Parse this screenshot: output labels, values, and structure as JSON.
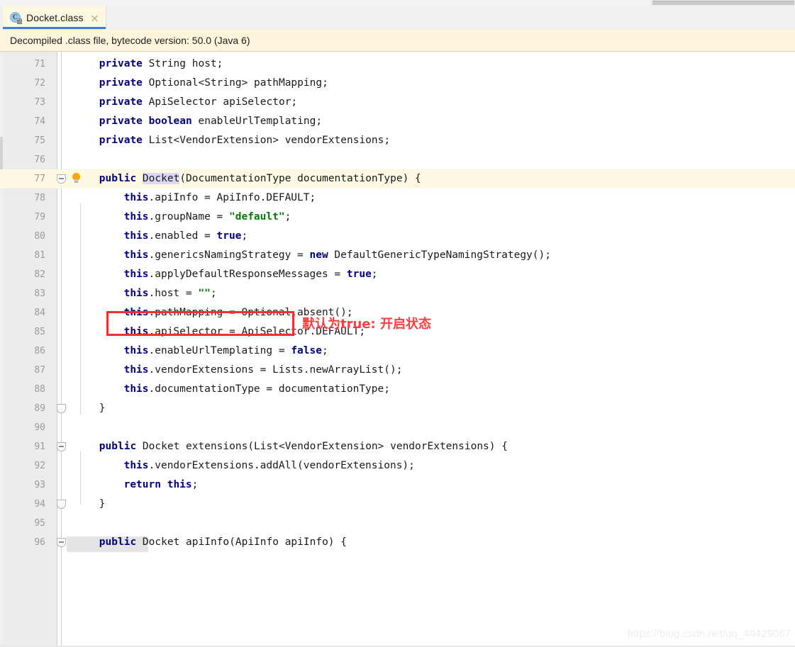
{
  "window": {
    "scrollbar_top": "horizontal-scrollbar"
  },
  "tab": {
    "label": "Docket.class",
    "icon": "java-class-icon",
    "icon_letter": "C",
    "close_label": "×",
    "active": true
  },
  "notice": {
    "text": "Decompiled .class file, bytecode version: 50.0 (Java 6)"
  },
  "editor": {
    "language": "java",
    "first_line": 71,
    "last_line": 96,
    "highlighted_line": 77,
    "selected_token": "Docket",
    "lines": [
      {
        "num": "71",
        "indent": 1,
        "tokens": [
          {
            "t": "private",
            "c": "kw"
          },
          {
            "t": " String host;",
            "c": "pln"
          }
        ]
      },
      {
        "num": "72",
        "indent": 1,
        "tokens": [
          {
            "t": "private",
            "c": "kw"
          },
          {
            "t": " Optional<String> pathMapping;",
            "c": "pln"
          }
        ]
      },
      {
        "num": "73",
        "indent": 1,
        "tokens": [
          {
            "t": "private",
            "c": "kw"
          },
          {
            "t": " ApiSelector apiSelector;",
            "c": "pln"
          }
        ]
      },
      {
        "num": "74",
        "indent": 1,
        "tokens": [
          {
            "t": "private",
            "c": "kw"
          },
          {
            "t": " ",
            "c": "pln"
          },
          {
            "t": "boolean",
            "c": "kw"
          },
          {
            "t": " enableUrlTemplating;",
            "c": "pln"
          }
        ]
      },
      {
        "num": "75",
        "indent": 1,
        "tokens": [
          {
            "t": "private",
            "c": "kw"
          },
          {
            "t": " List<VendorExtension> vendorExtensions;",
            "c": "pln"
          }
        ]
      },
      {
        "num": "76",
        "indent": 0,
        "tokens": []
      },
      {
        "num": "77",
        "indent": 1,
        "highlight": true,
        "fold": true,
        "bulb": true,
        "tokens": [
          {
            "t": "public",
            "c": "kw"
          },
          {
            "t": " ",
            "c": "pln"
          },
          {
            "t": "Docket",
            "c": "pln hlw"
          },
          {
            "t": "(DocumentationType documentationType) {",
            "c": "pln"
          }
        ]
      },
      {
        "num": "78",
        "indent": 2,
        "tokens": [
          {
            "t": "this",
            "c": "kw"
          },
          {
            "t": ".apiInfo = ApiInfo.DEFAULT;",
            "c": "pln"
          }
        ]
      },
      {
        "num": "79",
        "indent": 2,
        "tokens": [
          {
            "t": "this",
            "c": "kw"
          },
          {
            "t": ".groupName = ",
            "c": "pln"
          },
          {
            "t": "\"default\"",
            "c": "str"
          },
          {
            "t": ";",
            "c": "pln"
          }
        ]
      },
      {
        "num": "80",
        "indent": 2,
        "boxed": true,
        "tokens": [
          {
            "t": "this",
            "c": "kw"
          },
          {
            "t": ".enabled = ",
            "c": "pln"
          },
          {
            "t": "true",
            "c": "kw"
          },
          {
            "t": ";",
            "c": "pln"
          }
        ]
      },
      {
        "num": "81",
        "indent": 2,
        "tokens": [
          {
            "t": "this",
            "c": "kw"
          },
          {
            "t": ".genericsNamingStrategy = ",
            "c": "pln"
          },
          {
            "t": "new",
            "c": "kw"
          },
          {
            "t": " DefaultGenericTypeNamingStrategy();",
            "c": "pln"
          }
        ]
      },
      {
        "num": "82",
        "indent": 2,
        "tokens": [
          {
            "t": "this",
            "c": "kw"
          },
          {
            "t": ".applyDefaultResponseMessages = ",
            "c": "pln"
          },
          {
            "t": "true",
            "c": "kw"
          },
          {
            "t": ";",
            "c": "pln"
          }
        ]
      },
      {
        "num": "83",
        "indent": 2,
        "tokens": [
          {
            "t": "this",
            "c": "kw"
          },
          {
            "t": ".host = ",
            "c": "pln"
          },
          {
            "t": "\"\"",
            "c": "str"
          },
          {
            "t": ";",
            "c": "pln"
          }
        ]
      },
      {
        "num": "84",
        "indent": 2,
        "tokens": [
          {
            "t": "this",
            "c": "kw"
          },
          {
            "t": ".pathMapping = Optional.absent();",
            "c": "pln"
          }
        ]
      },
      {
        "num": "85",
        "indent": 2,
        "tokens": [
          {
            "t": "this",
            "c": "kw"
          },
          {
            "t": ".apiSelector = ApiSelector.DEFAULT;",
            "c": "pln"
          }
        ]
      },
      {
        "num": "86",
        "indent": 2,
        "tokens": [
          {
            "t": "this",
            "c": "kw"
          },
          {
            "t": ".enableUrlTemplating = ",
            "c": "pln"
          },
          {
            "t": "false",
            "c": "kw"
          },
          {
            "t": ";",
            "c": "pln"
          }
        ]
      },
      {
        "num": "87",
        "indent": 2,
        "tokens": [
          {
            "t": "this",
            "c": "kw"
          },
          {
            "t": ".vendorExtensions = Lists.newArrayList();",
            "c": "pln"
          }
        ]
      },
      {
        "num": "88",
        "indent": 2,
        "tokens": [
          {
            "t": "this",
            "c": "kw"
          },
          {
            "t": ".documentationType = documentationType;",
            "c": "pln"
          }
        ]
      },
      {
        "num": "89",
        "indent": 1,
        "foldEnd": true,
        "tokens": [
          {
            "t": "}",
            "c": "pln"
          }
        ]
      },
      {
        "num": "90",
        "indent": 0,
        "tokens": []
      },
      {
        "num": "91",
        "indent": 1,
        "fold": true,
        "tokens": [
          {
            "t": "public",
            "c": "kw"
          },
          {
            "t": " Docket extensions(List<VendorExtension> vendorExtensions) {",
            "c": "pln"
          }
        ]
      },
      {
        "num": "92",
        "indent": 2,
        "tokens": [
          {
            "t": "this",
            "c": "kw"
          },
          {
            "t": ".vendorExtensions.addAll(vendorExtensions);",
            "c": "pln"
          }
        ]
      },
      {
        "num": "93",
        "indent": 2,
        "tokens": [
          {
            "t": "return",
            "c": "kw"
          },
          {
            "t": " ",
            "c": "pln"
          },
          {
            "t": "this",
            "c": "kw"
          },
          {
            "t": ";",
            "c": "pln"
          }
        ]
      },
      {
        "num": "94",
        "indent": 1,
        "foldEnd": true,
        "tokens": [
          {
            "t": "}",
            "c": "pln"
          }
        ]
      },
      {
        "num": "95",
        "indent": 0,
        "tokens": []
      },
      {
        "num": "96",
        "indent": 1,
        "fold": true,
        "gutterSel": true,
        "tokens": [
          {
            "t": "public",
            "c": "kw"
          },
          {
            "t": " Docket apiInfo(ApiInfo apiInfo) {",
            "c": "pln"
          }
        ]
      }
    ]
  },
  "annotation": {
    "note_text": "默认为true: 开启状态",
    "note_color": "#fa4040",
    "box_color": "#f52f2f",
    "boxed_line": "80"
  },
  "watermark": {
    "text": "https://blog.csdn.net/qq_40429067"
  },
  "colors": {
    "keyword": "#000080",
    "string": "#008000",
    "tab_active_bg": "#fdf9e1",
    "tab_underline": "#3c7fd4",
    "notice_bg": "#fdf6dd",
    "line_highlight": "#fdf9e3",
    "token_highlight": "#dcd8f7",
    "gutter_bg": "#ececec"
  }
}
